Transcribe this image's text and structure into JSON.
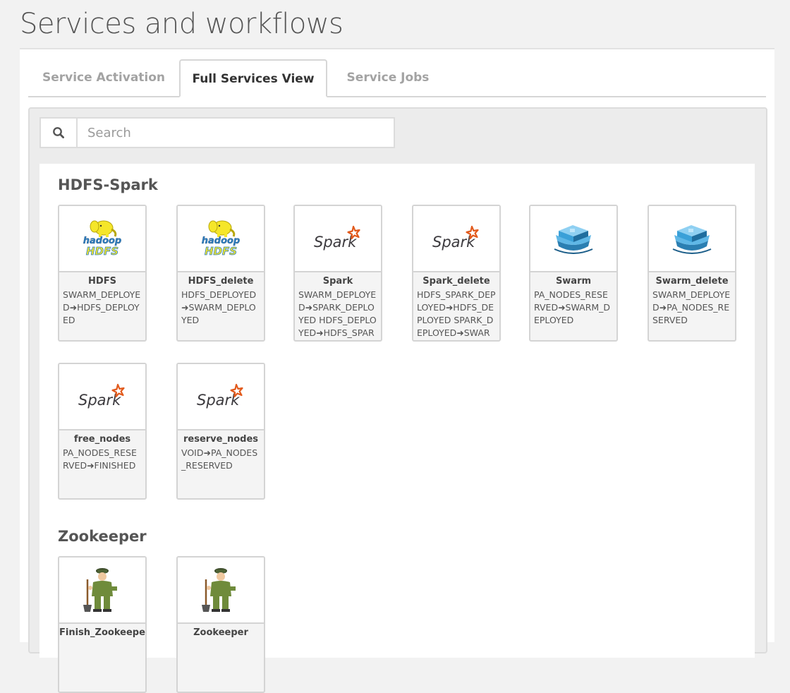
{
  "page": {
    "title": "Services and workflows"
  },
  "tabs": [
    {
      "label": "Service Activation",
      "active": false
    },
    {
      "label": "Full Services View",
      "active": true
    },
    {
      "label": "Service Jobs",
      "active": false
    }
  ],
  "search": {
    "placeholder": "Search",
    "value": "",
    "icon": "search-icon"
  },
  "groups": [
    {
      "title": "HDFS-Spark",
      "cards": [
        {
          "name": "HDFS",
          "description": "SWARM_DEPLOYED➜HDFS_DEPLOYED",
          "icon": "hadoop-hdfs-logo"
        },
        {
          "name": "HDFS_delete",
          "description": "HDFS_DEPLOYED➜SWARM_DEPLOYED",
          "icon": "hadoop-hdfs-logo"
        },
        {
          "name": "Spark",
          "description": "SWARM_DEPLOYED➜SPARK_DEPLOYED HDFS_DEPLOYED➜HDFS_SPARK_DEPLOYED",
          "icon": "spark-logo"
        },
        {
          "name": "Spark_delete",
          "description": "HDFS_SPARK_DEPLOYED➜HDFS_DEPLOYED SPARK_DEPLOYED➜SWARM_DEPLOYED",
          "icon": "spark-logo"
        },
        {
          "name": "Swarm",
          "description": "PA_NODES_RESERVED➜SWARM_DEPLOYED",
          "icon": "docker-swarm-logo"
        },
        {
          "name": "Swarm_delete",
          "description": "SWARM_DEPLOYED➜PA_NODES_RESERVED",
          "icon": "docker-swarm-logo"
        },
        {
          "name": "free_nodes",
          "description": "PA_NODES_RESERVED➜FINISHED",
          "icon": "spark-logo"
        },
        {
          "name": "reserve_nodes",
          "description": "VOID➜PA_NODES_RESERVED",
          "icon": "spark-logo"
        }
      ]
    },
    {
      "title": "Zookeeper",
      "cards": [
        {
          "name": "Finish_Zookeeper",
          "description": "",
          "icon": "zookeeper-logo"
        },
        {
          "name": "Zookeeper",
          "description": "",
          "icon": "zookeeper-logo"
        }
      ]
    }
  ],
  "logo_text": {
    "hadoop_top": "hadoop",
    "hadoop_bottom": "HDFS",
    "spark": "Spark"
  },
  "colors": {
    "spark_star": "#e25a1c",
    "hadoop_yellow": "#f5e62a",
    "hadoop_blue": "#2e7fc1",
    "docker_blue": "#3aa0d8"
  }
}
